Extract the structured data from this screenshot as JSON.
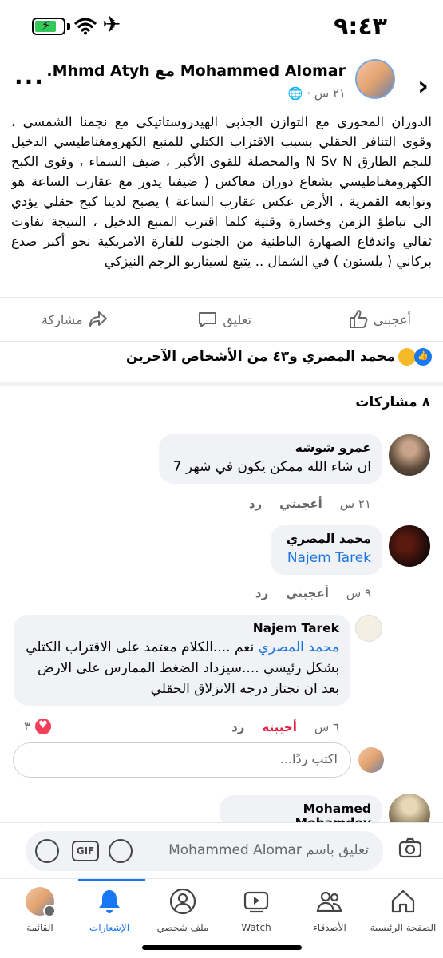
{
  "status_bar": {
    "time": "٩:٤٣"
  },
  "header": {
    "title": "Mohammed Alomar مع Mhmd Atyh.",
    "time": "٢١ س",
    "globe": "🌐"
  },
  "post": {
    "text": "الدوران المحوري مع التوازن الجذبي الهيدروستاتيكي مع نجمنا الشمسي ، وقوى التنافر الحقلي بسبب الاقتراب الكتلي للمنبع الكهرومغناطيسي الدخيل للنجم الطارق N Sv N والمحصلة للقوى الأكبر ، ضيف السماء ، وقوى الكبح الكهرومغناطيسي بشعاع دوران معاكس ( ضيفنا يدور مع عقارب الساعة هو وتوابعه القمرية ، الأرض عكس عقارب الساعة ) يصبح لدينا كبح حقلي يؤدي الى تباطؤ الزمن وخسارة وقتية كلما اقترب المنبع الدخيل ، النتيجة تفاوت ثقالي واندفاع الصهارة الباطنية من الجنوب للقارة الامريكية نحو أكبر صدع بركاني ( يلستون ) في الشمال .. يتبع لسيناريو الرجم النيزكي"
  },
  "actions": {
    "like": "أعجبني",
    "comment": "تعليق",
    "share": "مشاركة"
  },
  "reactions": {
    "summary": "محمد المصري و٤٣ من الأشخاص الآخرين"
  },
  "shares": {
    "label": "٨ مشاركات"
  },
  "comments": [
    {
      "name": "عمرو شوشه",
      "text": "ان شاء الله ممكن يكون في شهر 7",
      "time": "٢١ س",
      "like": "أعجبني",
      "reply": "رد"
    },
    {
      "name": "محمد المصري",
      "mention": "Najem Tarek",
      "time": "٩ س",
      "like": "أعجبني",
      "reply": "رد"
    },
    {
      "name": "Najem Tarek",
      "mention": "محمد المصري",
      "text": " نعم ....الكلام معتمد على الاقتراب الكتلي بشكل رئيسي ....سيزداد الضغط الممارس على الارض بعد ان نجتاز درجه الانزلاق الحقلي",
      "time": "٦ س",
      "like": "أحببته",
      "reply": "رد",
      "reaction_count": "٣"
    },
    {
      "name": "Mohamed Mohamdey"
    }
  ],
  "reply_box": {
    "placeholder": "اكتب ردًا..."
  },
  "composer": {
    "placeholder": "تعليق باسم Mohammed Alomar",
    "gif": "GIF"
  },
  "nav": {
    "tabs": [
      {
        "label": "الصفحة الرئيسية"
      },
      {
        "label": "الأصدقاء"
      },
      {
        "label": "Watch"
      },
      {
        "label": "ملف شخصي"
      },
      {
        "label": "الإشعارات"
      },
      {
        "label": "القائمة"
      }
    ]
  },
  "colors": {
    "accent": "#1877f2",
    "love": "#e41e3f",
    "bubble": "#f0f2f5",
    "link": "#1b74e4"
  }
}
